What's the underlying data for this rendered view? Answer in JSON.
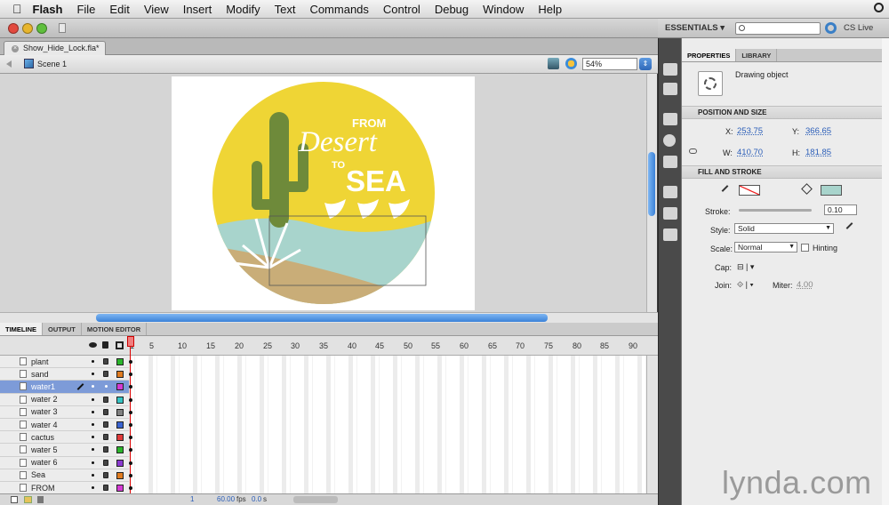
{
  "menubar": {
    "apple_icon": "apple-icon",
    "items": [
      "Flash",
      "File",
      "Edit",
      "View",
      "Insert",
      "Modify",
      "Text",
      "Commands",
      "Control",
      "Debug",
      "Window",
      "Help"
    ]
  },
  "workspace": {
    "label": "ESSENTIALS ▾",
    "search_placeholder": "",
    "cs_live": "CS Live"
  },
  "document": {
    "tab": "Show_Hide_Lock.fla*",
    "scene": "Scene 1",
    "zoom": "54%"
  },
  "artwork": {
    "line1": "FROM",
    "line2": "Desert",
    "line3": "TO",
    "line4": "SEA"
  },
  "timeline": {
    "tabs": [
      "TIMELINE",
      "OUTPUT",
      "MOTION EDITOR"
    ],
    "frame_numbers": [
      "1",
      "5",
      "10",
      "15",
      "20",
      "25",
      "30",
      "35",
      "40",
      "45",
      "50",
      "55",
      "60",
      "65",
      "70",
      "75",
      "80",
      "85",
      "90"
    ],
    "layers": [
      {
        "name": "plant",
        "color": "#2bb52b"
      },
      {
        "name": "sand",
        "color": "#e07b1f"
      },
      {
        "name": "water1",
        "color": "#d43bd4",
        "selected": true
      },
      {
        "name": "water 2",
        "color": "#36c4c4"
      },
      {
        "name": "water 3",
        "color": "#808080"
      },
      {
        "name": "water 4",
        "color": "#3a63d0"
      },
      {
        "name": "cactus",
        "color": "#e03a3a"
      },
      {
        "name": "water 5",
        "color": "#2bb52b"
      },
      {
        "name": "water 6",
        "color": "#8a3ad0"
      },
      {
        "name": "Sea",
        "color": "#e07b1f"
      },
      {
        "name": "FROM",
        "color": "#d43bd4"
      }
    ],
    "status": {
      "frame": "1",
      "fps": "60.00",
      "fps_unit": "fps",
      "time": "0.0",
      "time_unit": "s"
    }
  },
  "properties": {
    "tabs": [
      "PROPERTIES",
      "LIBRARY"
    ],
    "object_type": "Drawing object",
    "position_section": "POSITION AND SIZE",
    "x_label": "X:",
    "x": "253.75",
    "y_label": "Y:",
    "y": "366.65",
    "w_label": "W:",
    "w": "410.70",
    "h_label": "H:",
    "h": "181.85",
    "fill_section": "FILL AND STROKE",
    "stroke_label": "Stroke:",
    "stroke_value": "0.10",
    "style_label": "Style:",
    "style_value": "Solid",
    "scale_label": "Scale:",
    "scale_value": "Normal",
    "hinting_label": "Hinting",
    "cap_label": "Cap:",
    "join_label": "Join:",
    "miter_label": "Miter:",
    "miter_value": "4.00",
    "fill_color": "#a8d4cc"
  },
  "watermark": "lynda.com"
}
